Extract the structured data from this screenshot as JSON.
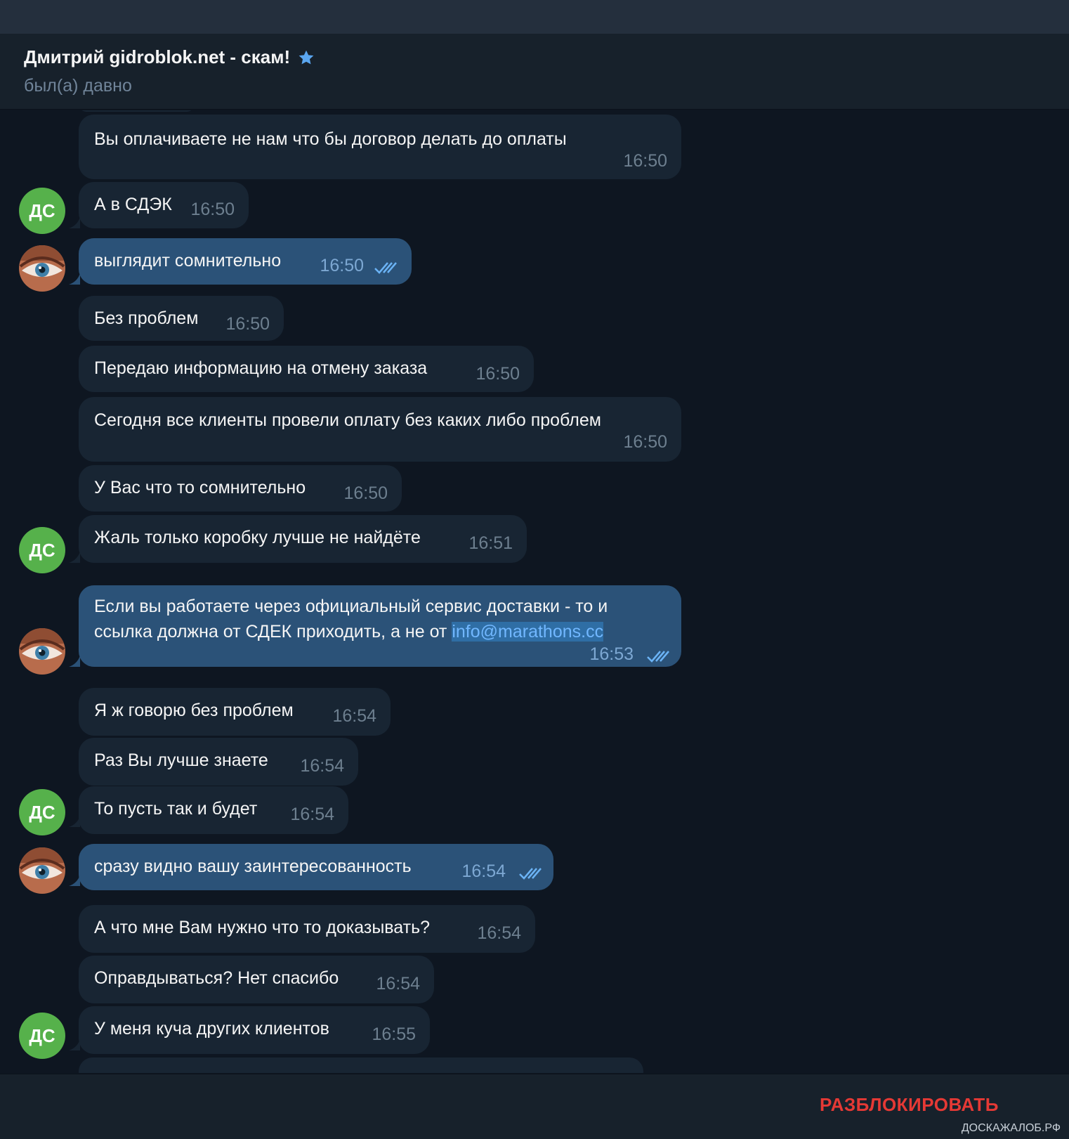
{
  "header": {
    "title": "Дмитрий gidroblok.net - скам!",
    "status": "был(а) давно"
  },
  "avatar_initials": "ДС",
  "messages": [
    {
      "text": "Вы оплачиваете не нам что бы договор делать до оплаты",
      "time": "16:50"
    },
    {
      "text": "А в СДЭК",
      "time": "16:50"
    },
    {
      "text": "выглядит сомнительно",
      "time": "16:50"
    },
    {
      "text": "Без проблем",
      "time": "16:50"
    },
    {
      "text": "Передаю информацию на отмену заказа",
      "time": "16:50"
    },
    {
      "text": "Сегодня все клиенты провели оплату без каких либо проблем",
      "time": "16:50"
    },
    {
      "text": "У Вас что то сомнительно",
      "time": "16:50"
    },
    {
      "text": "Жаль только коробку лучше не найдёте",
      "time": "16:51"
    },
    {
      "line1": "Если вы работаете через официальный сервис доставки - то и",
      "line2_prefix": "ссылка должна от СДЕК приходить, а не от ",
      "link": "info@marathons.cc",
      "time": "16:53"
    },
    {
      "text": "Я ж говорю без проблем",
      "time": "16:54"
    },
    {
      "text": "Раз Вы лучше знаете",
      "time": "16:54"
    },
    {
      "text": "То пусть так и будет",
      "time": "16:54"
    },
    {
      "text": "сразу видно вашу заинтересованность",
      "time": "16:54"
    },
    {
      "text": "А что мне Вам нужно что то доказывать?",
      "time": "16:54"
    },
    {
      "text": "Оправдываться? Нет спасибо",
      "time": "16:54"
    },
    {
      "text": "У меня куча других клиентов",
      "time": "16:55"
    }
  ],
  "footer": {
    "unblock_label": "РАЗБЛОКИРОВАТЬ",
    "watermark": "ДОСКАЖАЛОБ.РФ"
  },
  "colors": {
    "incoming_bubble": "#182533",
    "outgoing_bubble": "#2b5278",
    "avatar_green": "#56b14b",
    "unblock_red": "#e53935",
    "star_blue": "#5aa6f0"
  }
}
